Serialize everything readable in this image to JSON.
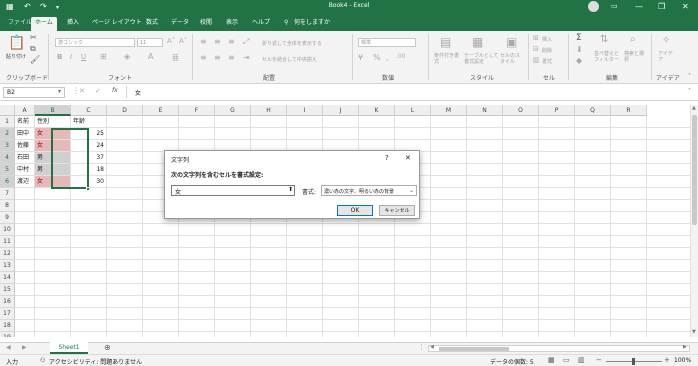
{
  "titlebar": {
    "title": "Book4 - Excel",
    "qat_autosave": "▦",
    "qat_undo": "↶",
    "qat_redo": "↷",
    "qat_custom": "▾",
    "user_icon": "user-avatar-icon",
    "minimize": "—",
    "restore": "❐",
    "close": "✕",
    "accent": "#217346"
  },
  "tabs": [
    "ファイル",
    "ホーム",
    "挿入",
    "ページ レイアウト",
    "数式",
    "データ",
    "校閲",
    "表示",
    "ヘルプ"
  ],
  "tell_me": "何をしますか",
  "ribbon": {
    "clipboard": {
      "paste": "貼り付け",
      "label": "クリップボード"
    },
    "font": {
      "font_name": "游ゴシック",
      "font_size": "11",
      "label": "フォント"
    },
    "alignment": {
      "wrap": "折り返して全体を表示する",
      "merge": "セルを結合して中央揃え",
      "label": "配置"
    },
    "number": {
      "format": "標準",
      "label": "数値"
    },
    "styles": {
      "cond": "条件付き書式",
      "table": "テーブルとして書式設定",
      "cell": "セルのスタイル",
      "label": "スタイル"
    },
    "cells": {
      "insert": "挿入",
      "delete": "削除",
      "format": "書式",
      "label": "セル"
    },
    "editing": {
      "sum": "Σ",
      "sort": "並べ替えとフィルター",
      "find": "検索と選択",
      "label": "編集"
    },
    "ideas": {
      "btn": "アイデア",
      "label": "アイデア"
    }
  },
  "formula_bar": {
    "name_box": "B2",
    "fx": "fx",
    "value": "女"
  },
  "columns": [
    "A",
    "B",
    "C",
    "D",
    "E",
    "F",
    "G",
    "H",
    "I",
    "J",
    "K",
    "L",
    "M",
    "N",
    "O",
    "P",
    "Q",
    "R"
  ],
  "rows": [
    "1",
    "2",
    "3",
    "4",
    "5",
    "6",
    "7",
    "8",
    "9",
    "10",
    "11",
    "12",
    "13",
    "14",
    "15",
    "16",
    "17",
    "18",
    "19"
  ],
  "cells": {
    "A1": "名前",
    "B1": "性別",
    "C1": "年齢",
    "A2": "田中",
    "B2": "女",
    "C2": "25",
    "A3": "佐藤",
    "B3": "女",
    "C3": "24",
    "A4": "石田",
    "B4": "男",
    "C4": "37",
    "A5": "中村",
    "B5": "男",
    "C5": "18",
    "A6": "渡辺",
    "B6": "女",
    "C6": "30"
  },
  "highlight": {
    "female_fill": "#e6b8b7",
    "female_text": "#9c0006",
    "selected_fill": "#d0d0d0"
  },
  "dialog": {
    "title": "文字列",
    "help": "?",
    "close": "✕",
    "prompt": "次の文字列を含むセルを書式設定:",
    "input_value": "女",
    "format_label": "書式:",
    "format_value": "濃い赤の文字、明るい赤の背景",
    "ok": "OK",
    "cancel": "キャンセル"
  },
  "sheet_tabs": {
    "active": "Sheet1",
    "add": "⊕"
  },
  "status": {
    "mode": "入力",
    "accessibility": "アクセシビリティ: 問題ありません",
    "count": "データの個数: 5",
    "zoom": "100%"
  }
}
